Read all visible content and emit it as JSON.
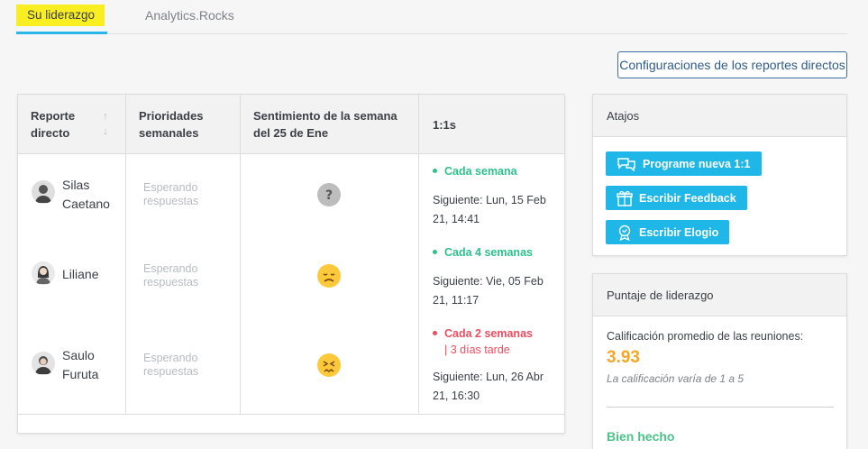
{
  "tabs": [
    {
      "label": "Su liderazgo",
      "active": true
    },
    {
      "label": "Analytics.Rocks",
      "active": false
    }
  ],
  "config_button": "Configuraciones de los reportes directos",
  "table": {
    "headers": {
      "report": "Reporte directo",
      "priorities": "Prioridades semanales",
      "sentiment": "Sentimiento de la semana del 25 de Ene",
      "oneonones": "1:1s"
    },
    "rows": [
      {
        "name": "Silas Caetano",
        "priorities": "Esperando respuestas",
        "mood": "unknown",
        "frequency": "Cada semana",
        "late": "",
        "frequency_color": "#2cc28a",
        "next": "Siguiente: Lun, 15 Feb 21, 14:41"
      },
      {
        "name": "Liliane",
        "priorities": "Esperando respuestas",
        "mood": "sad",
        "frequency": "Cada 4 semanas",
        "late": "",
        "frequency_color": "#2cc28a",
        "next": "Siguiente: Vie, 05 Feb 21, 11:17"
      },
      {
        "name": "Saulo Furuta",
        "priorities": "Esperando respuestas",
        "mood": "stressed",
        "frequency": "Cada 2 semanas",
        "late": "| 3 días tarde",
        "frequency_color": "#ef4d5f",
        "next": "Siguiente: Lun, 26 Abr 21, 16:30"
      }
    ]
  },
  "shortcuts": {
    "title": "Atajos",
    "buttons": [
      {
        "label": "Programe nueva 1:1",
        "icon": "chat-bubbles-icon"
      },
      {
        "label": "Escribir Feedback",
        "icon": "gift-icon"
      },
      {
        "label": "Escribir Elogio",
        "icon": "award-ribbon-icon"
      }
    ]
  },
  "leadership": {
    "title": "Puntaje de liderazgo",
    "avg_label": "Calificación promedio de las reuniones:",
    "avg_value": "3.93",
    "note": "La calificación varía de 1 a 5",
    "status": "Bien hecho"
  },
  "colors": {
    "accent": "#1fb7e8",
    "highlight": "#f9ee22",
    "positive": "#2cc28a",
    "negative": "#ef4d5f",
    "score": "#f5a623"
  }
}
